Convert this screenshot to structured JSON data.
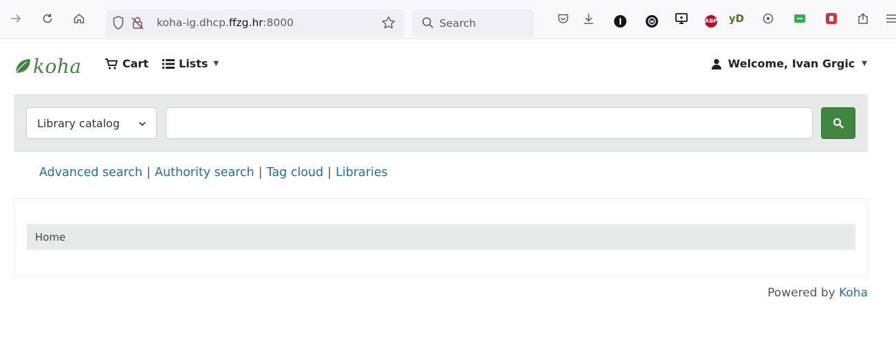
{
  "browser": {
    "url_prefix": "koha-ig.dhcp.",
    "url_domain": "ffzg.hr",
    "url_suffix": ":8000",
    "search_placeholder": "Search",
    "extension_labels": {
      "abp": "ABP",
      "yd": "yD"
    }
  },
  "header": {
    "logo_text": "koha",
    "cart_label": "Cart",
    "lists_label": "Lists",
    "welcome_label": "Welcome, Ivan Grgic"
  },
  "search": {
    "catalog_selected": "Library catalog",
    "query_value": ""
  },
  "links": {
    "advanced_search": "Advanced search",
    "authority_search": "Authority search",
    "tag_cloud": "Tag cloud",
    "libraries": "Libraries",
    "separator": "|"
  },
  "breadcrumb": {
    "home": "Home"
  },
  "footer": {
    "powered_by": "Powered by",
    "koha_link": "Koha"
  },
  "colors": {
    "brand_green": "#408540",
    "link_blue": "#1e6fa8",
    "panel_gray": "#e6eae9"
  }
}
